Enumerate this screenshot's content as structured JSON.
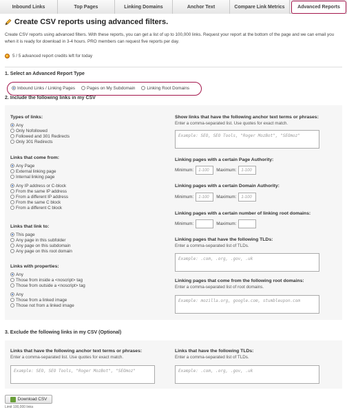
{
  "tabs": [
    {
      "label": "Inbound Links"
    },
    {
      "label": "Top Pages"
    },
    {
      "label": "Linking Domains"
    },
    {
      "label": "Anchor Text"
    },
    {
      "label": "Compare Link Metrics"
    },
    {
      "label": "Advanced Reports",
      "active": true
    }
  ],
  "header": {
    "title": "Create CSV reports using advanced filters.",
    "intro": "Create CSV reports using advanced filters. With these reports, you can get a list of up to 100,000 links. Request your report at the bottom of the page and we can email you when it is ready for download in 3-4 hours. PRO members can request five reports per day.",
    "credits": "5 / 5 advanced report credits left for today"
  },
  "section1": {
    "title": "1. Select an Advanced Report Type",
    "options": [
      "Inbound Links / Linking Pages",
      "Pages on My Subdomain",
      "Linking Root Domains"
    ],
    "selected": 0
  },
  "section2": {
    "title": "2. Include the following links in my CSV",
    "types_of_links": {
      "title": "Types of links:",
      "options": [
        "Any",
        "Only Nofollowed",
        "Followed and 301 Redirects",
        "Only 301 Redirects"
      ]
    },
    "links_from": {
      "title": "Links that come from:",
      "options_a": [
        "Any Page",
        "External linking page",
        "Internal linking page"
      ],
      "options_b": [
        "Any IP address or C-block",
        "From the same IP address",
        "From a different IP address",
        "From the same C block",
        "From a different C block"
      ]
    },
    "links_to": {
      "title": "Links that link to:",
      "options": [
        "This page",
        "Any page in this subfolder",
        "Any page on this subdomain",
        "Any page on this root domain"
      ]
    },
    "links_props": {
      "title": "Links with properties:",
      "options_a": [
        "Any",
        "Those from inside a <noscript> tag",
        "Those from outside a <noscript> tag"
      ],
      "options_b": [
        "Any",
        "Those from a linked image",
        "Those not from a linked image"
      ]
    },
    "anchor": {
      "title": "Show links that have the following anchor text terms or phrases:",
      "sub": "Enter a comma-separated list. Use quotes for exact match.",
      "placeholder": "Example: SEO, SEO Tools, \"Roger MozBot\", \"SEOmoz\""
    },
    "pa": {
      "title": "Linking pages with a certain Page Authority:",
      "min_label": "Minimum:",
      "max_label": "Maximum:",
      "min_ph": "1-100",
      "max_ph": "1-100"
    },
    "da": {
      "title": "Linking pages with a certain Domain Authority:",
      "min_label": "Minimum:",
      "max_label": "Maximum:",
      "min_ph": "1-100",
      "max_ph": "1-100"
    },
    "lrd": {
      "title": "Linking pages with a certain number of linking root domains:",
      "min_label": "Minimum:",
      "max_label": "Maximum:",
      "min_ph": "",
      "max_ph": ""
    },
    "tlds": {
      "title": "Linking pages that have the following TLDs:",
      "sub": "Enter a comma-separated list of TLDs.",
      "placeholder": "Example: .com, .org, .gov, .uk"
    },
    "roots": {
      "title": "Linking pages that come from the following root domains:",
      "sub": "Enter a comma-separated list of root domains.",
      "placeholder": "Example: mozilla.org, google.com, stumbleupon.com"
    }
  },
  "section3": {
    "title": "3. Exclude the following links in my CSV (Optional)",
    "anchor": {
      "title": "Links that have the following anchor text terms or phrases:",
      "sub": "Enter a comma-separated list. Use quotes for exact match.",
      "placeholder": "Example: SEO, SEO Tools, \"Roger MozBot\", \"SEOmoz\""
    },
    "tlds": {
      "title": "Links that have the following TLDs:",
      "sub": "Enter a comma-separated list of TLDs.",
      "placeholder": "Example: .com, .org, .gov, .uk"
    }
  },
  "footer": {
    "button_label": "Download CSV",
    "limit": "Limit 100,000 links"
  },
  "colors": {
    "accent": "#a3154b",
    "radio_dot": "#2a5db0"
  }
}
